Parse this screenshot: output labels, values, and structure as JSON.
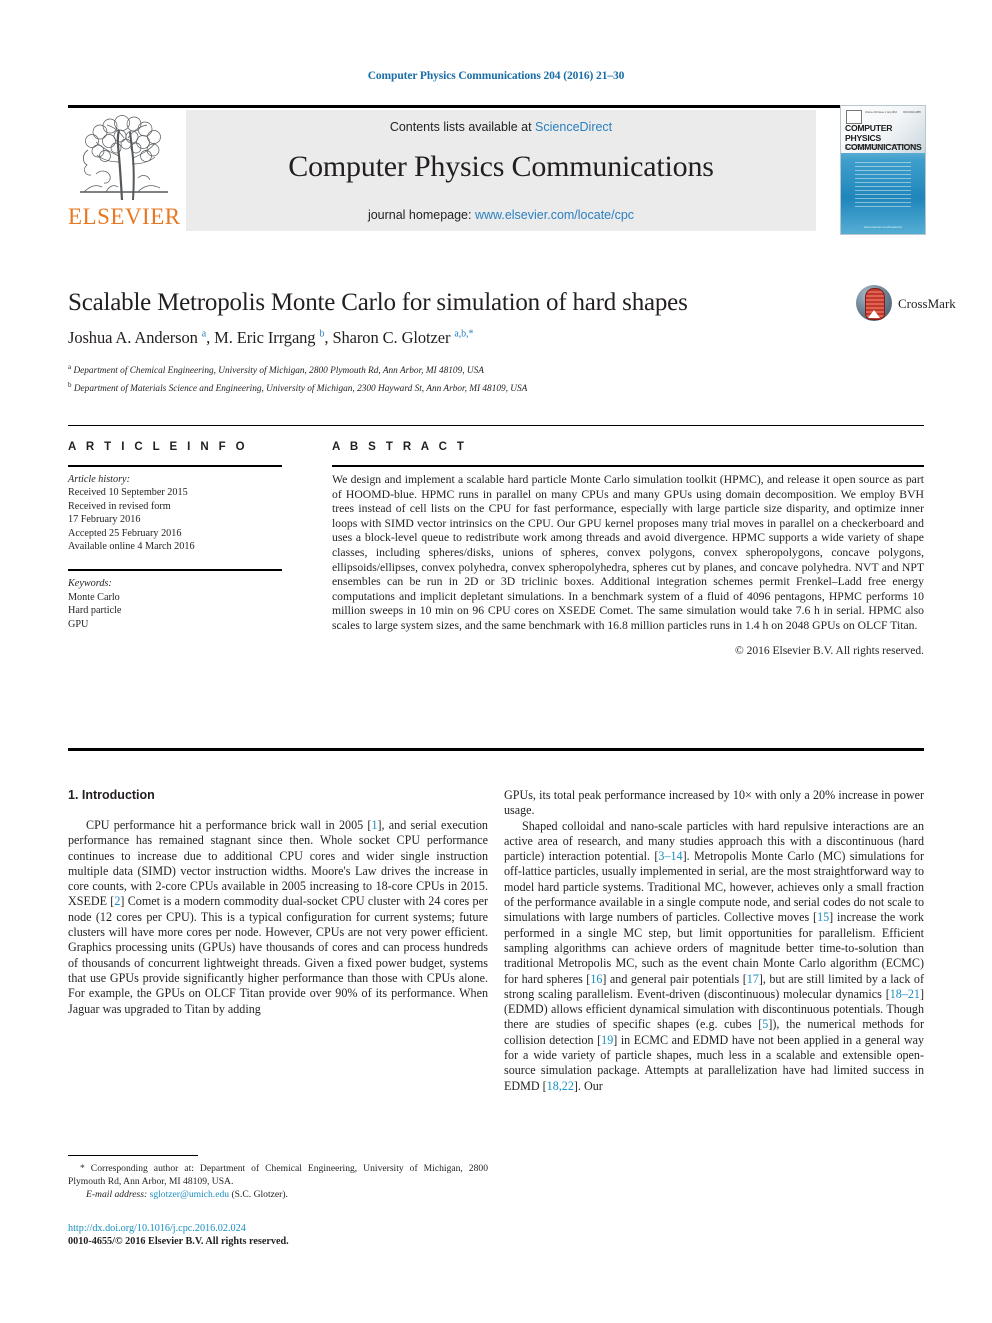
{
  "running_head": "Computer Physics Communications 204 (2016) 21–30",
  "masthead": {
    "contents_prefix": "Contents lists available at ",
    "sciencedirect": "ScienceDirect",
    "journal_name": "Computer Physics Communications",
    "homepage_label": "journal homepage: ",
    "homepage_url": "www.elsevier.com/locate/cpc",
    "publisher": "ELSEVIER",
    "cover": {
      "title": "COMPUTER PHYSICS COMMUNICATIONS",
      "subtitle": "An international journal and program library for computational physics and physical chemistry",
      "volume_line": "Volume 204 Issue 1 July 2016",
      "issn_line": "ISSN 0010-4655",
      "footer": "www.elsevier.com/locate/cpc"
    }
  },
  "article": {
    "title": "Scalable Metropolis Monte Carlo for simulation of hard shapes",
    "crossmark_label": "CrossMark",
    "authors_html": "Joshua A. Anderson <sup>a</sup>, M. Eric Irrgang <sup>b</sup>, Sharon C. Glotzer <sup>a,b,</sup><sup>*</sup>",
    "affiliation_a": "Department of Chemical Engineering, University of Michigan, 2800 Plymouth Rd, Ann Arbor, MI 48109, USA",
    "affiliation_b": "Department of Materials Science and Engineering, University of Michigan, 2300 Hayward St, Ann Arbor, MI 48109, USA"
  },
  "info": {
    "heading": "A R T I C L E    I N F O",
    "history_label": "Article history:",
    "history": [
      "Received 10 September 2015",
      "Received in revised form",
      "17 February 2016",
      "Accepted 25 February 2016",
      "Available online 4 March 2016"
    ],
    "keywords_label": "Keywords:",
    "keywords": [
      "Monte Carlo",
      "Hard particle",
      "GPU"
    ]
  },
  "abstract": {
    "heading": "A B S T R A C T",
    "text": "We design and implement a scalable hard particle Monte Carlo simulation toolkit (HPMC), and release it open source as part of HOOMD-blue. HPMC runs in parallel on many CPUs and many GPUs using domain decomposition. We employ BVH trees instead of cell lists on the CPU for fast performance, especially with large particle size disparity, and optimize inner loops with SIMD vector intrinsics on the CPU. Our GPU kernel proposes many trial moves in parallel on a checkerboard and uses a block-level queue to redistribute work among threads and avoid divergence. HPMC supports a wide variety of shape classes, including spheres/disks, unions of spheres, convex polygons, convex spheropolygons, concave polygons, ellipsoids/ellipses, convex polyhedra, convex spheropolyhedra, spheres cut by planes, and concave polyhedra. NVT and NPT ensembles can be run in 2D or 3D triclinic boxes. Additional integration schemes permit Frenkel–Ladd free energy computations and implicit depletant simulations. In a benchmark system of a fluid of 4096 pentagons, HPMC performs 10 million sweeps in 10 min on 96 CPU cores on XSEDE Comet. The same simulation would take 7.6 h in serial. HPMC also scales to large system sizes, and the same benchmark with 16.8 million particles runs in 1.4 h on 2048 GPUs on OLCF Titan.",
    "copyright": "© 2016 Elsevier B.V. All rights reserved."
  },
  "body": {
    "section_heading": "1. Introduction",
    "left_paragraph_1": "CPU performance hit a performance brick wall in 2005 [1], and serial execution performance has remained stagnant since then. Whole socket CPU performance continues to increase due to additional CPU cores and wider single instruction multiple data (SIMD) vector instruction widths. Moore's Law drives the increase in core counts, with 2-core CPUs available in 2005 increasing to 18-core CPUs in 2015. XSEDE [2] Comet is a modern commodity dual-socket CPU cluster with 24 cores per node (12 cores per CPU). This is a typical configuration for current systems; future clusters will have more cores per node. However, CPUs are not very power efficient. Graphics processing units (GPUs) have thousands of cores and can process hundreds of thousands of concurrent lightweight threads. Given a fixed power budget, systems that use GPUs provide significantly higher performance than those with CPUs alone. For example, the GPUs on OLCF Titan provide over 90% of its performance. When Jaguar was upgraded to Titan by adding",
    "right_paragraph_1": "GPUs, its total peak performance increased by 10× with only a 20% increase in power usage.",
    "right_paragraph_2": "Shaped colloidal and nano-scale particles with hard repulsive interactions are an active area of research, and many studies approach this with a discontinuous (hard particle) interaction potential. [3–14]. Metropolis Monte Carlo (MC) simulations for off-lattice particles, usually implemented in serial, are the most straightforward way to model hard particle systems. Traditional MC, however, achieves only a small fraction of the performance available in a single compute node, and serial codes do not scale to simulations with large numbers of particles. Collective moves [15] increase the work performed in a single MC step, but limit opportunities for parallelism. Efficient sampling algorithms can achieve orders of magnitude better time-to-solution than traditional Metropolis MC, such as the event chain Monte Carlo algorithm (ECMC) for hard spheres [16] and general pair potentials [17], but are still limited by a lack of strong scaling parallelism. Event-driven (discontinuous) molecular dynamics [18–21] (EDMD) allows efficient dynamical simulation with discontinuous potentials. Though there are studies of specific shapes (e.g. cubes [5]), the numerical methods for collision detection [19] in ECMC and EDMD have not been applied in a general way for a wide variety of particle shapes, much less in a scalable and extensible open-source simulation package. Attempts at parallelization have had limited success in EDMD [18,22]. Our"
  },
  "footer": {
    "corresponding_star": "*",
    "corresponding_text": "Corresponding author at: Department of Chemical Engineering, University of Michigan, 2800 Plymouth Rd, Ann Arbor, MI 48109, USA.",
    "email_label": "E-mail address:",
    "email": "sglotzer@umich.edu",
    "email_owner": "(S.C. Glotzer).",
    "doi_url": "http://dx.doi.org/10.1016/j.cpc.2016.02.024",
    "issn_line": "0010-4655/© 2016 Elsevier B.V. All rights reserved."
  },
  "colors": {
    "link_blue": "#2a7fc0",
    "ref_blue": "#1a8fc1",
    "head_blue": "#1a6ea8",
    "elsevier_orange": "#E87722",
    "band_gray": "#ebebeb"
  }
}
